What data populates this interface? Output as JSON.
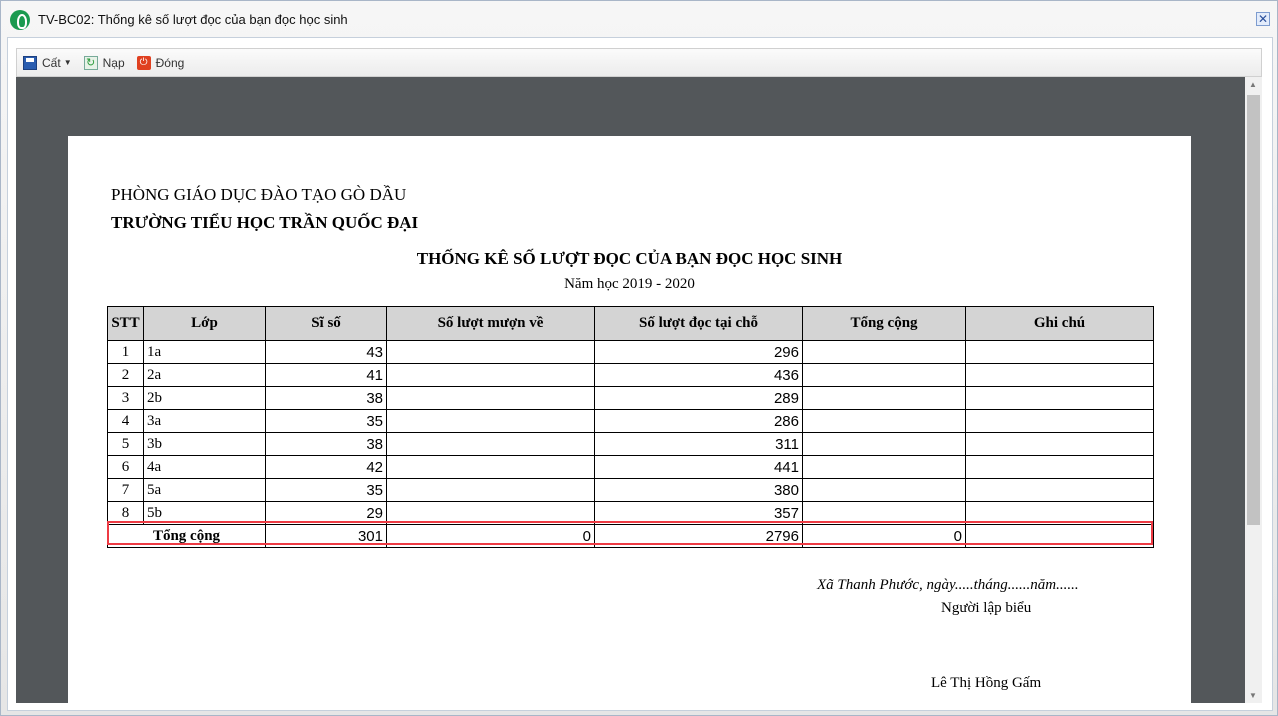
{
  "window": {
    "title": "TV-BC02: Thống kê số lượt đọc của bạn đọc học sinh",
    "close": "✕"
  },
  "toolbar": {
    "save": "Cất",
    "reload": "Nạp",
    "close": "Đóng"
  },
  "report": {
    "org": "PHÒNG GIÁO DỤC ĐÀO TẠO GÒ DẦU",
    "school": "TRƯỜNG TIỂU HỌC TRẦN QUỐC ĐẠI",
    "title": "THỐNG KÊ SỐ LƯỢT ĐỌC CỦA BẠN ĐỌC HỌC SINH",
    "year": "Năm học 2019 - 2020",
    "headers": [
      "STT",
      "Lớp",
      "Sĩ số",
      "Số lượt mượn về",
      "Số lượt đọc tại chỗ",
      "Tổng cộng",
      "Ghi chú"
    ],
    "rows": [
      [
        "1",
        "1a",
        "43",
        "",
        "296",
        "",
        ""
      ],
      [
        "2",
        "2a",
        "41",
        "",
        "436",
        "",
        ""
      ],
      [
        "3",
        "2b",
        "38",
        "",
        "289",
        "",
        ""
      ],
      [
        "4",
        "3a",
        "35",
        "",
        "286",
        "",
        ""
      ],
      [
        "5",
        "3b",
        "38",
        "",
        "311",
        "",
        ""
      ],
      [
        "6",
        "4a",
        "42",
        "",
        "441",
        "",
        ""
      ],
      [
        "7",
        "5a",
        "35",
        "",
        "380",
        "",
        ""
      ],
      [
        "8",
        "5b",
        "29",
        "",
        "357",
        "",
        ""
      ]
    ],
    "total": {
      "label": "Tổng cộng",
      "si_so": "301",
      "muon": "0",
      "doc": "2796",
      "tong": "0",
      "ghi_chu": ""
    },
    "place_date": "Xã Thanh Phước, ngày.....tháng......năm......",
    "signer_title": "Người lập biểu",
    "signer_name": "Lê Thị Hồng Gấm"
  }
}
